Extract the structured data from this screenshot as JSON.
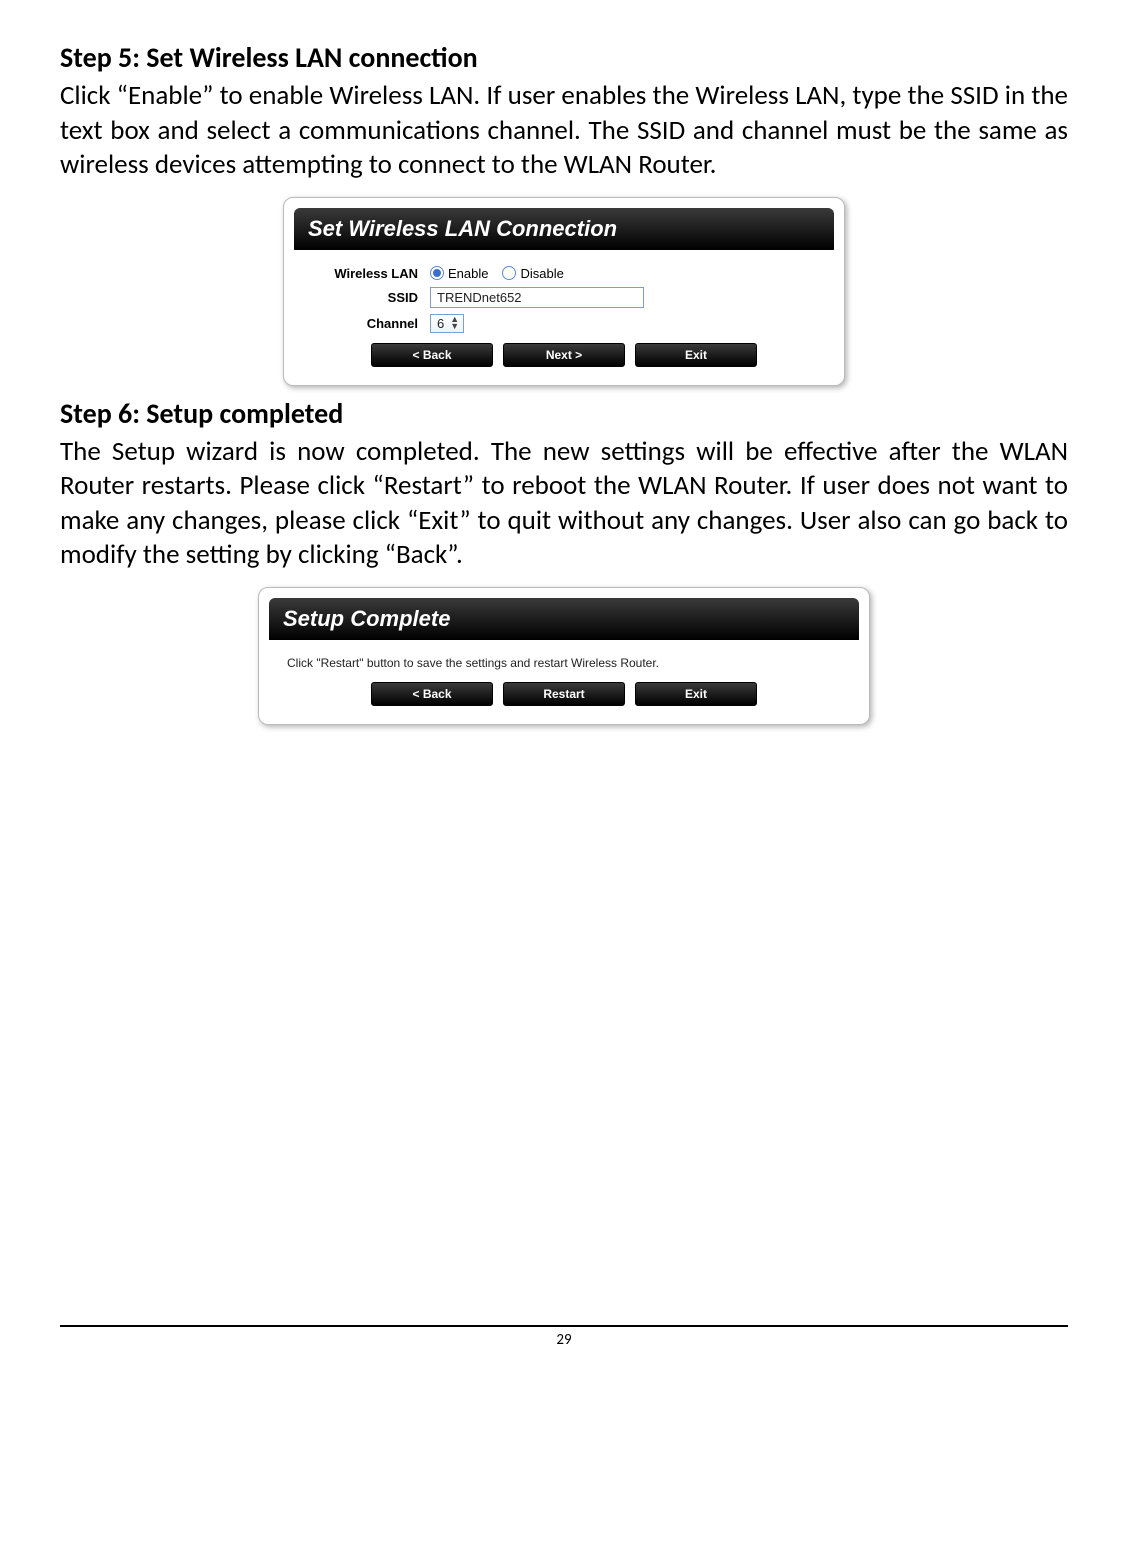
{
  "step5": {
    "heading": "Step 5: Set Wireless LAN connection",
    "body": "Click “Enable” to enable Wireless LAN. If user enables the Wireless LAN, type the SSID in the text box and select a communications channel. The SSID and channel must be the same as wireless devices attempting to connect to the WLAN Router."
  },
  "wlan_panel": {
    "title": "Set Wireless LAN Connection",
    "rows": {
      "wlan_label": "Wireless LAN",
      "enable_label": "Enable",
      "disable_label": "Disable",
      "ssid_label": "SSID",
      "ssid_value": "TRENDnet652",
      "channel_label": "Channel",
      "channel_value": "6"
    },
    "buttons": {
      "back": "<  Back",
      "next": "Next  >",
      "exit": "Exit"
    }
  },
  "step6": {
    "heading": "Step 6: Setup completed",
    "body": "The Setup wizard is now completed. The new settings will be effective after the WLAN Router restarts. Please click “Restart” to reboot the WLAN Router. If user does not want to make any changes, please click “Exit” to quit without any changes. User also can go back to modify the setting by clicking “Back”."
  },
  "complete_panel": {
    "title": "Setup Complete",
    "hint": "Click \"Restart\" button to save the settings and restart Wireless Router.",
    "buttons": {
      "back": "<  Back",
      "restart": "Restart",
      "exit": "Exit"
    }
  },
  "page_number": "29"
}
